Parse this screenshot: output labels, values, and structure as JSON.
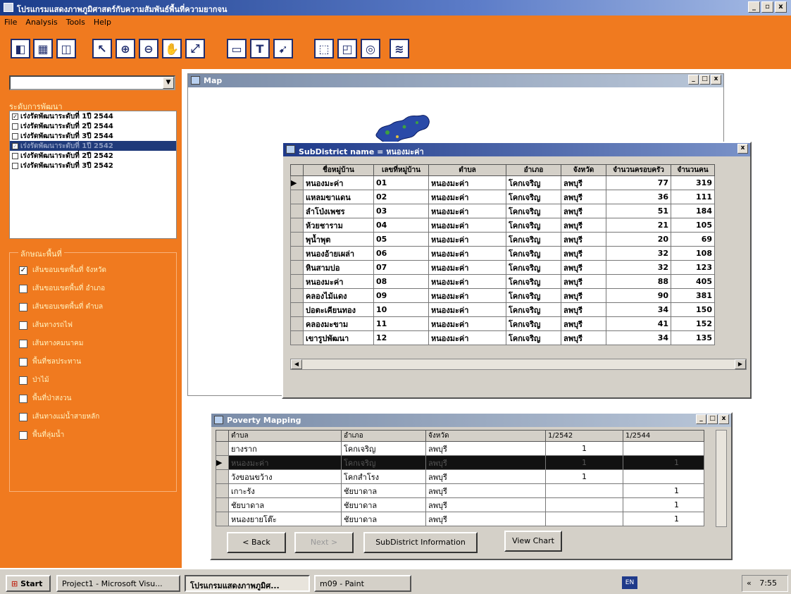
{
  "window": {
    "title": "โปรแกรมแสดงภาพภูมิศาสตร์กับความสัมพันธ์พื้นที่ความยากจน",
    "min": "_",
    "max": "▫",
    "close": "x"
  },
  "menu": [
    "File",
    "Analysis",
    "Tools",
    "Help"
  ],
  "toolbar": {
    "icons": [
      "layer-icon",
      "table-icon",
      "table3d-icon",
      "pointer-icon",
      "zoom-in-icon",
      "zoom-out-icon",
      "pan-icon",
      "measure-icon",
      "label-icon",
      "text-icon",
      "pin-icon",
      "select-icon",
      "select-rect-icon",
      "select-circle-icon",
      "layers-icon"
    ]
  },
  "left": {
    "combo_value": "",
    "levels_label": "ระดับการพัฒนา",
    "levels": [
      {
        "label": "เร่งรัดพัฒนาระดับที่ 1ปี 2544",
        "checked": true
      },
      {
        "label": "เร่งรัดพัฒนาระดับที่ 2ปี 2544",
        "checked": false
      },
      {
        "label": "เร่งรัดพัฒนาระดับที่ 3ปี 2544",
        "checked": false
      },
      {
        "label": "เร่งรัดพัฒนาระดับที่ 1ปี 2542",
        "checked": true
      },
      {
        "label": "เร่งรัดพัฒนาระดับที่ 2ปี 2542",
        "checked": false
      },
      {
        "label": "เร่งรัดพัฒนาระดับที่ 3ปี 2542",
        "checked": false
      }
    ],
    "layers_label": "ลักษณะพื้นที่",
    "layers": [
      {
        "label": "เส้นขอบเขตพื้นที่ จังหวัด",
        "checked": true
      },
      {
        "label": "เส้นขอบเขตพื้นที่ อำเภอ",
        "checked": false
      },
      {
        "label": "เส้นขอบเขตพื้นที่ ตำบล",
        "checked": false
      },
      {
        "label": "เส้นทางรถไฟ",
        "checked": false
      },
      {
        "label": "เส้นทางคมนาคม",
        "checked": false
      },
      {
        "label": "พื้นที่ชลประทาน",
        "checked": false
      },
      {
        "label": "ป่าไม้",
        "checked": false
      },
      {
        "label": "พื้นที่ป่าสงวน",
        "checked": false
      },
      {
        "label": "เส้นทางแม่น้ำสายหลัก",
        "checked": false
      },
      {
        "label": "พื้นที่ลุ่มน้ำ",
        "checked": false
      }
    ]
  },
  "map": {
    "title": "Map"
  },
  "subdistrict": {
    "title": "SubDistrict name = หนองมะค่า",
    "columns": [
      "ชื่อหมู่บ้าน",
      "เลขที่หมู่บ้าน",
      "ตำบล",
      "อำเภอ",
      "จังหวัด",
      "จำนวนครอบครัว",
      "จำนวนคน"
    ],
    "rows": [
      [
        "หนองมะค่า",
        "01",
        "หนองมะค่า",
        "โคกเจริญ",
        "ลพบุรี",
        "77",
        "319"
      ],
      [
        "แหลมขาแดน",
        "02",
        "หนองมะค่า",
        "โคกเจริญ",
        "ลพบุรี",
        "36",
        "111"
      ],
      [
        "ลำโป่งเพชร",
        "03",
        "หนองมะค่า",
        "โคกเจริญ",
        "ลพบุรี",
        "51",
        "184"
      ],
      [
        "ห้วยชาราม",
        "04",
        "หนองมะค่า",
        "โคกเจริญ",
        "ลพบุรี",
        "21",
        "105"
      ],
      [
        "พุน้ำพุต",
        "05",
        "หนองมะค่า",
        "โคกเจริญ",
        "ลพบุรี",
        "20",
        "69"
      ],
      [
        "หนองอ้ายเผล่า",
        "06",
        "หนองมะค่า",
        "โคกเจริญ",
        "ลพบุรี",
        "32",
        "108"
      ],
      [
        "หินสามบ่อ",
        "07",
        "หนองมะค่า",
        "โคกเจริญ",
        "ลพบุรี",
        "32",
        "123"
      ],
      [
        "หนองมะค่า",
        "08",
        "หนองมะค่า",
        "โคกเจริญ",
        "ลพบุรี",
        "88",
        "405"
      ],
      [
        "คลองไม้แดง",
        "09",
        "หนองมะค่า",
        "โคกเจริญ",
        "ลพบุรี",
        "90",
        "381"
      ],
      [
        "ปอตะเคียนทอง",
        "10",
        "หนองมะค่า",
        "โคกเจริญ",
        "ลพบุรี",
        "34",
        "150"
      ],
      [
        "คลองมะขาม",
        "11",
        "หนองมะค่า",
        "โคกเจริญ",
        "ลพบุรี",
        "41",
        "152"
      ],
      [
        "เขารูปพัฒนา",
        "12",
        "หนองมะค่า",
        "โคกเจริญ",
        "ลพบุรี",
        "34",
        "135"
      ]
    ]
  },
  "poverty": {
    "title": "Poverty Mapping",
    "columns": [
      "ตำบล",
      "อำเภอ",
      "จังหวัด",
      "1/2542",
      "1/2544"
    ],
    "rows": [
      [
        "ยางราก",
        "โคกเจริญ",
        "ลพบุรี",
        "1",
        ""
      ],
      [
        "หนองมะค่า",
        "โคกเจริญ",
        "ลพบุรี",
        "1",
        "1"
      ],
      [
        "วังขอนขว้าง",
        "โคกสำโรง",
        "ลพบุรี",
        "1",
        ""
      ],
      [
        "เกาะรัง",
        "ชัยบาดาล",
        "ลพบุรี",
        "",
        "1"
      ],
      [
        "ชัยบาดาล",
        "ชัยบาดาล",
        "ลพบุรี",
        "",
        "1"
      ],
      [
        "หนองยายโต๊ะ",
        "ชัยบาดาล",
        "ลพบุรี",
        "",
        "1"
      ]
    ],
    "selected_row": 1,
    "buttons": {
      "back": "< Back",
      "next": "Next >",
      "info": "SubDistrict Information",
      "chart": "View Chart"
    }
  },
  "taskbar": {
    "start": "Start",
    "tasks": [
      {
        "label": "Project1 - Microsoft Visu...",
        "active": false
      },
      {
        "label": "โปรแกรมแสดงภาพภูมิศ...",
        "active": true
      },
      {
        "label": "m09 - Paint",
        "active": false
      }
    ],
    "lang": "EN",
    "arrows": "«",
    "clock": "7:55"
  }
}
